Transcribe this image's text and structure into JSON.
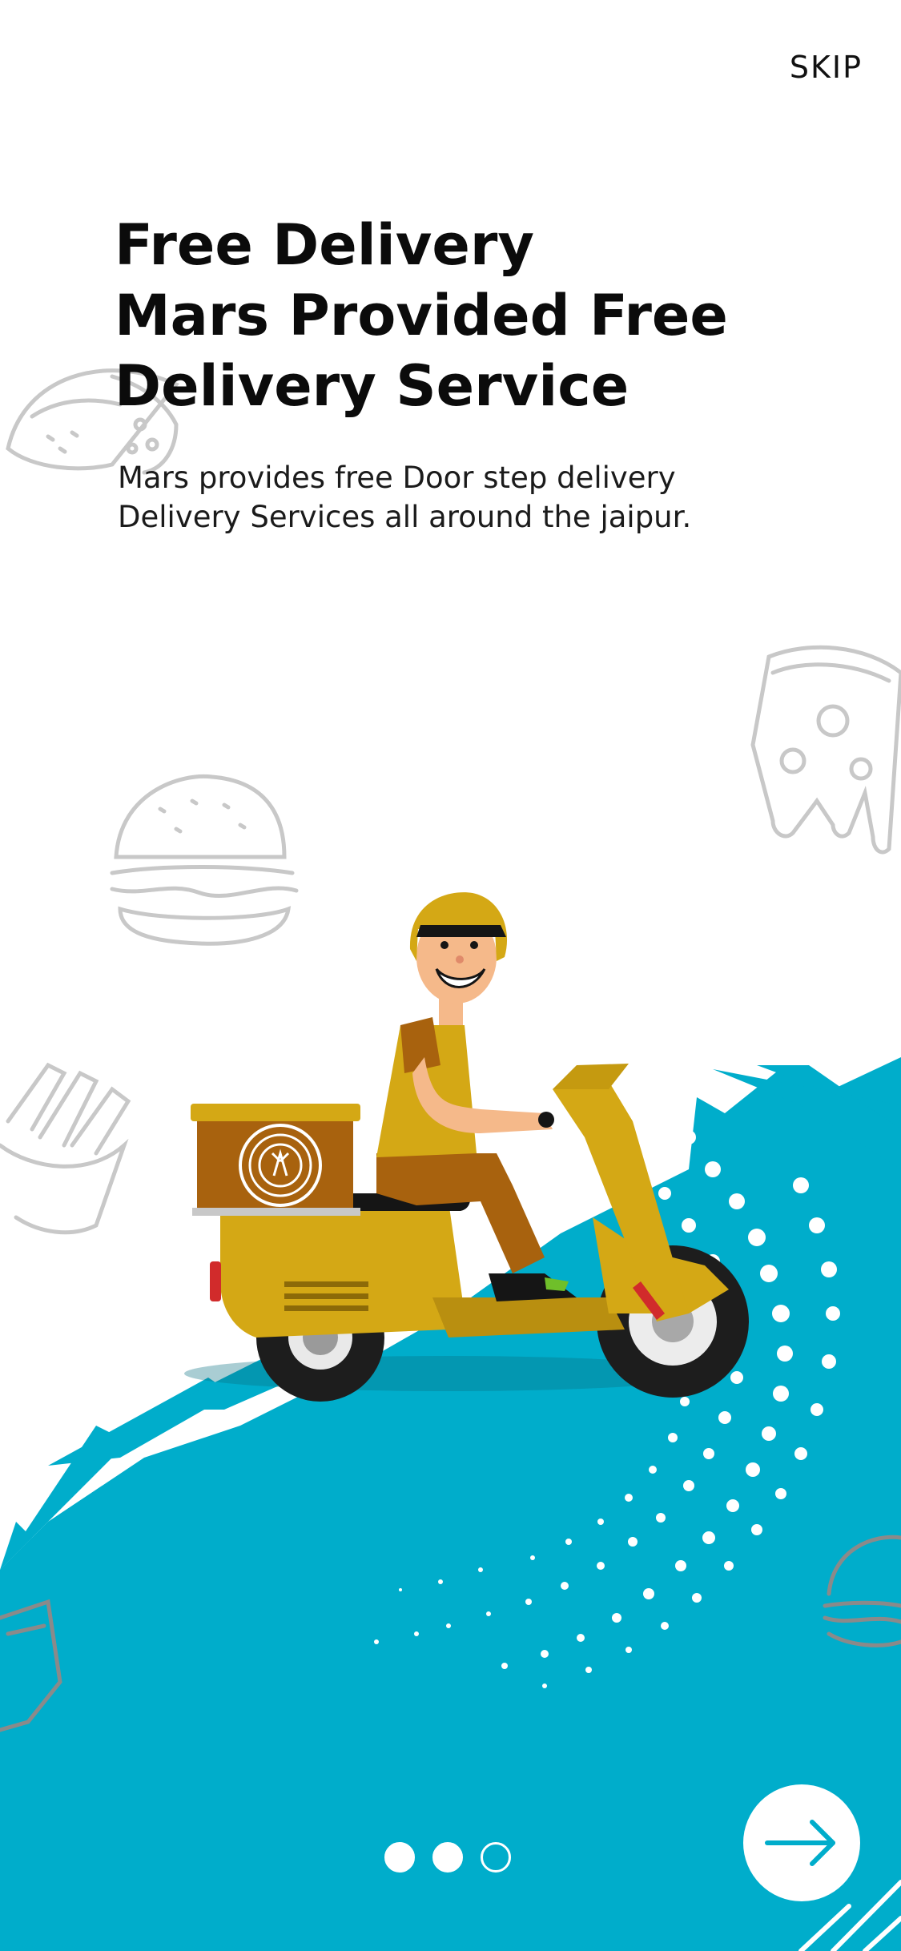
{
  "header": {
    "skip_label": "SKIP"
  },
  "onboarding": {
    "title_lines": [
      "Free Delivery",
      "Mars Provided Free",
      "Delivery Service"
    ],
    "description_lines": [
      "Mars provides free Door step delivery",
      "Delivery Services all around the jaipur."
    ]
  },
  "pager": {
    "total": 3,
    "active": [
      0,
      1
    ]
  },
  "colors": {
    "accent": "#00ADCB",
    "scooter": "#D4A815",
    "box": "#A8620E"
  },
  "icons": {
    "next": "arrow-right-icon"
  }
}
